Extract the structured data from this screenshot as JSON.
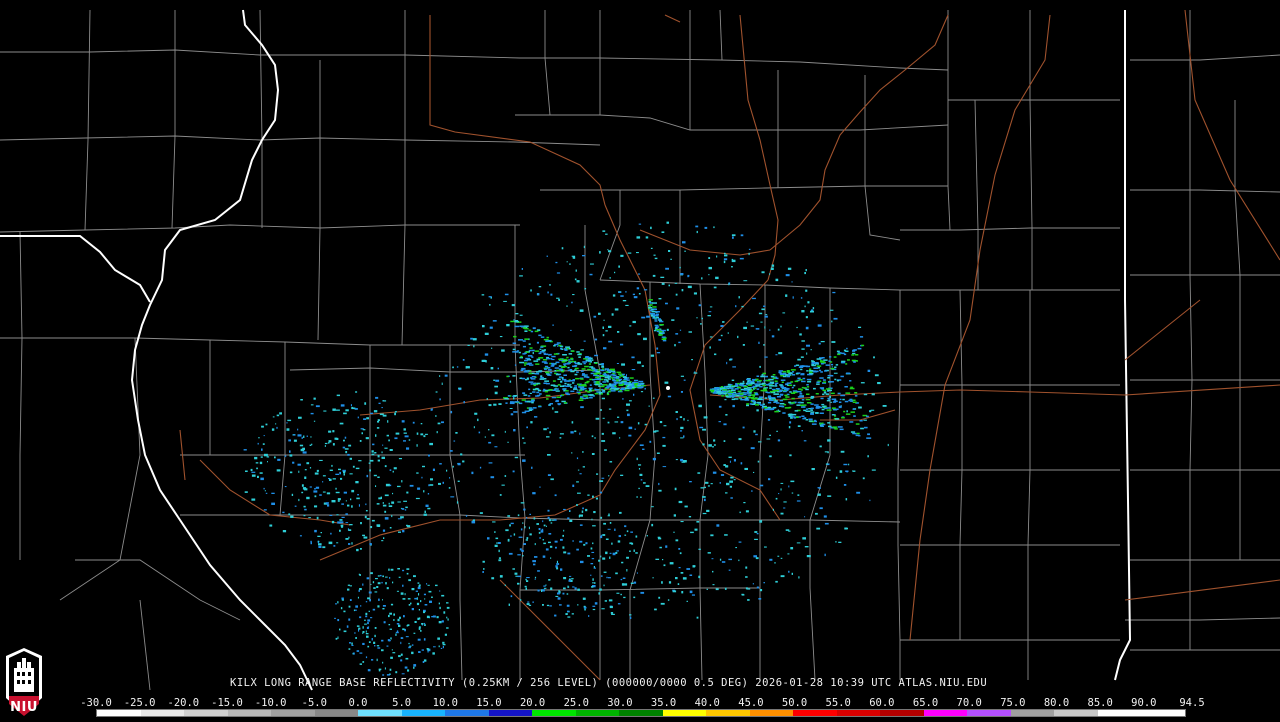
{
  "map": {
    "radar_site": "KILX",
    "product": "LONG RANGE BASE REFLECTIVITY",
    "caption": "KILX LONG RANGE BASE REFLECTIVITY (0.25KM / 256 LEVEL) (000000/0000 0.5 DEG) 2026-01-28 10:39 UTC  ATLAS.NIU.EDU",
    "timestamp": "2026-01-28 10:39 UTC",
    "source": "ATLAS.NIU.EDU"
  },
  "legend": {
    "labels": [
      "-30.0",
      "-25.0",
      "-20.0",
      "-15.0",
      "-10.0",
      "-5.0",
      "0.0",
      "5.0",
      "10.0",
      "15.0",
      "20.0",
      "25.0",
      "30.0",
      "35.0",
      "40.0",
      "45.0",
      "50.0",
      "55.0",
      "60.0",
      "65.0",
      "70.0",
      "75.0",
      "80.0",
      "85.0",
      "90.0",
      "94.5"
    ],
    "colors": [
      "#ffffff",
      "#e8e8e8",
      "#d0d0d0",
      "#b8b8b8",
      "#a0a0a0",
      "#888888",
      "#6fe0ff",
      "#18b4ff",
      "#1e78e8",
      "#1414c8",
      "#00e600",
      "#00b400",
      "#008200",
      "#ffff00",
      "#ffc800",
      "#ff9000",
      "#ff0000",
      "#d80000",
      "#b40000",
      "#ff00ff",
      "#b450ff",
      "#a0a0a0",
      "#c8c8c8",
      "#ffffff",
      "#ffffff"
    ]
  },
  "logo": {
    "text": "NIU",
    "accent_color": "#c8102e"
  },
  "colors": {
    "county_lines": "#8c8c8c",
    "state_lines": "#ffffff",
    "highways": "#a0522d",
    "light_echo": "#2ecfd8",
    "mid_echo": "#1f8fe8",
    "strong_echo": "#1bd11b",
    "peak_echo": "#ffa000"
  }
}
